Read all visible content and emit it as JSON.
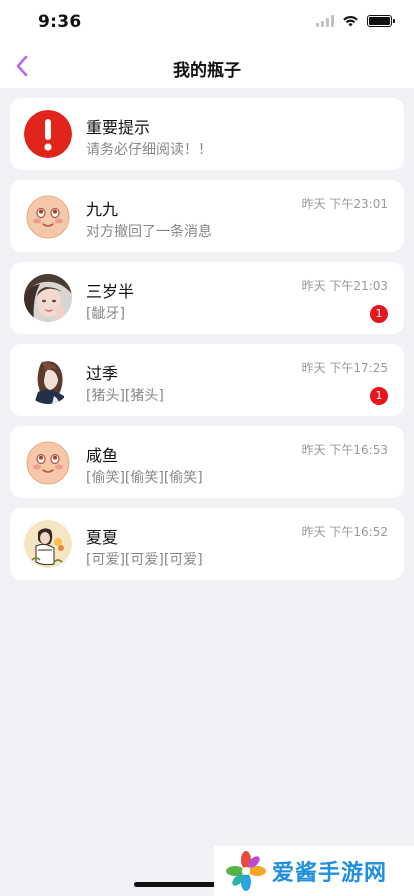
{
  "status_bar": {
    "time": "9:36"
  },
  "nav": {
    "title": "我的瓶子"
  },
  "conversations": [
    {
      "name": "重要提示",
      "preview": "请务必仔细阅读！！",
      "time": "",
      "badge": "",
      "avatar_icon": "alert-icon"
    },
    {
      "name": "九九",
      "preview": "对方撤回了一条消息",
      "time": "昨天 下午23:01",
      "badge": "",
      "avatar_icon": "blush-face-avatar"
    },
    {
      "name": "三岁半",
      "preview": "[龇牙]",
      "time": "昨天 下午21:03",
      "badge": "1",
      "avatar_icon": "girl-photo-avatar"
    },
    {
      "name": "过季",
      "preview": "[猪头][猪头]",
      "time": "昨天 下午17:25",
      "badge": "1",
      "avatar_icon": "illustrated-girl-avatar"
    },
    {
      "name": "咸鱼",
      "preview": "[偷笑][偷笑][偷笑]",
      "time": "昨天 下午16:53",
      "badge": "",
      "avatar_icon": "blush-face-avatar"
    },
    {
      "name": "夏夏",
      "preview": "[可爱][可爱][可爱]",
      "time": "昨天 下午16:52",
      "badge": "",
      "avatar_icon": "cartoon-girl-avatar"
    }
  ],
  "watermark": {
    "text": "爱酱手游网"
  },
  "colors": {
    "accent": "#b36bff",
    "badge": "#e8141e",
    "alert": "#e1251b"
  }
}
